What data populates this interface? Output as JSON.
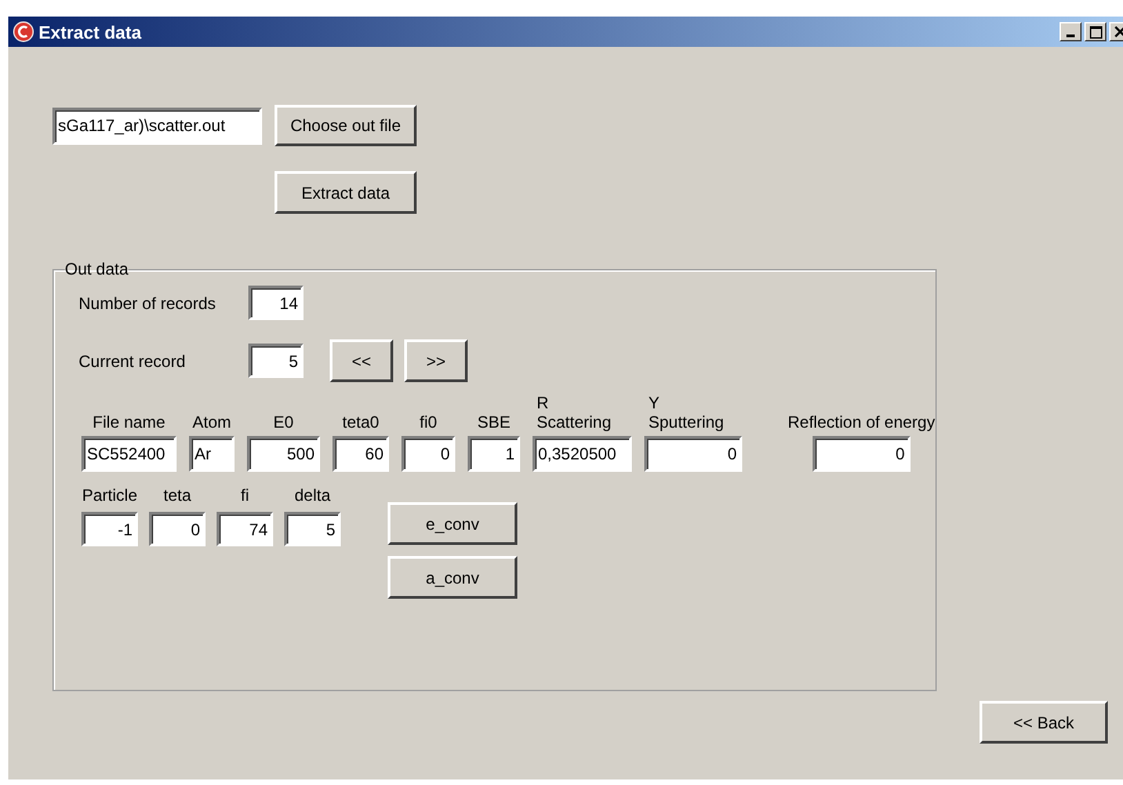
{
  "window": {
    "title": "Extract data"
  },
  "file": {
    "path": "sGa117_ar)\\scatter.out",
    "choose_button": "Choose out file",
    "extract_button": "Extract data"
  },
  "out_data": {
    "title": "Out data",
    "number_of_records": {
      "label": "Number of records",
      "value": "14"
    },
    "current_record": {
      "label": "Current record",
      "value": "5"
    },
    "nav_buttons": [
      "<<",
      ">>"
    ],
    "fields": [
      {
        "label": "File name",
        "value": "SC552400",
        "kind": "text"
      },
      {
        "label": "Atom",
        "value": "Ar",
        "kind": "text"
      },
      {
        "label": "E0",
        "value": "500",
        "kind": "number"
      },
      {
        "label": "teta0",
        "value": "60",
        "kind": "number"
      },
      {
        "label": "fi0",
        "value": "0",
        "kind": "number"
      },
      {
        "label": "SBE",
        "value": "1",
        "kind": "number"
      },
      {
        "symbol": "R",
        "label": "Scattering",
        "value": "0,3520500",
        "kind": "text"
      },
      {
        "symbol": "Y",
        "label": "Sputtering",
        "value": "0",
        "kind": "number"
      },
      {
        "label": "Reflection of energy",
        "value": "0",
        "kind": "number"
      }
    ],
    "particle_fields": [
      {
        "label": "Particle",
        "value": "-1"
      },
      {
        "label": "teta",
        "value": "0"
      },
      {
        "label": "fi",
        "value": "74"
      },
      {
        "label": "delta",
        "value": "5"
      }
    ],
    "buttons": [
      "e_conv",
      "a_conv"
    ]
  },
  "back_button": "<< Back"
}
